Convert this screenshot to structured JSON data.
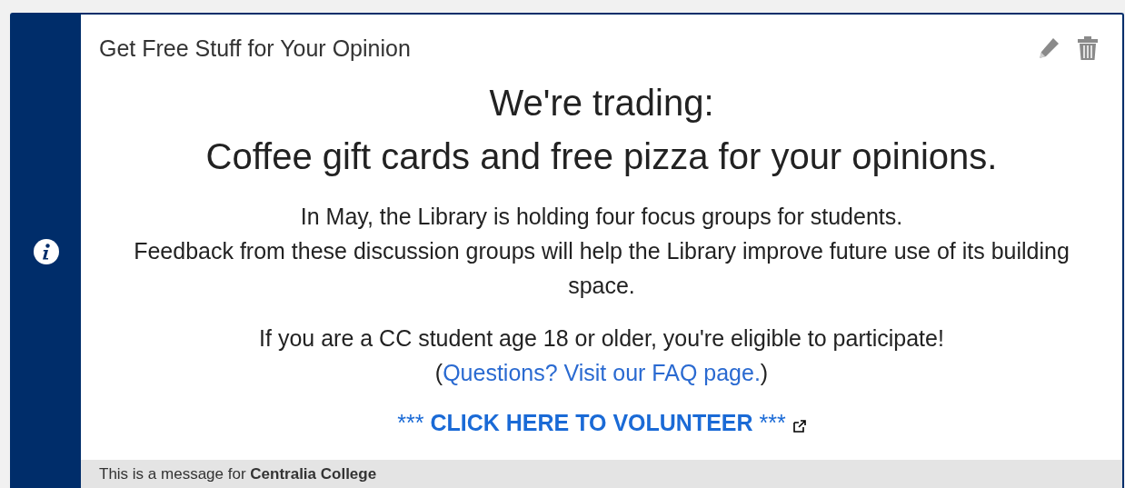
{
  "message": {
    "title": "Get Free Stuff for Your Opinion",
    "headings": [
      "We're trading:",
      "Coffee gift cards and free pizza for your opinions."
    ],
    "paragraph_1": [
      "In May, the Library is holding four focus groups for students.",
      "Feedback from these discussion groups will help the Library improve future use of its building space."
    ],
    "paragraph_2": {
      "text": "If you are a CC student age 18 or older, you're eligible to participate!",
      "link_prefix": "(",
      "link": "Questions? Visit our FAQ page.",
      "link_suffix": ")"
    },
    "volunteer_link": {
      "prefix": "***",
      "label": "CLICK HERE TO VOLUNTEER",
      "suffix": "***"
    },
    "footer": "This is a message for **Centralia College**"
  }
}
